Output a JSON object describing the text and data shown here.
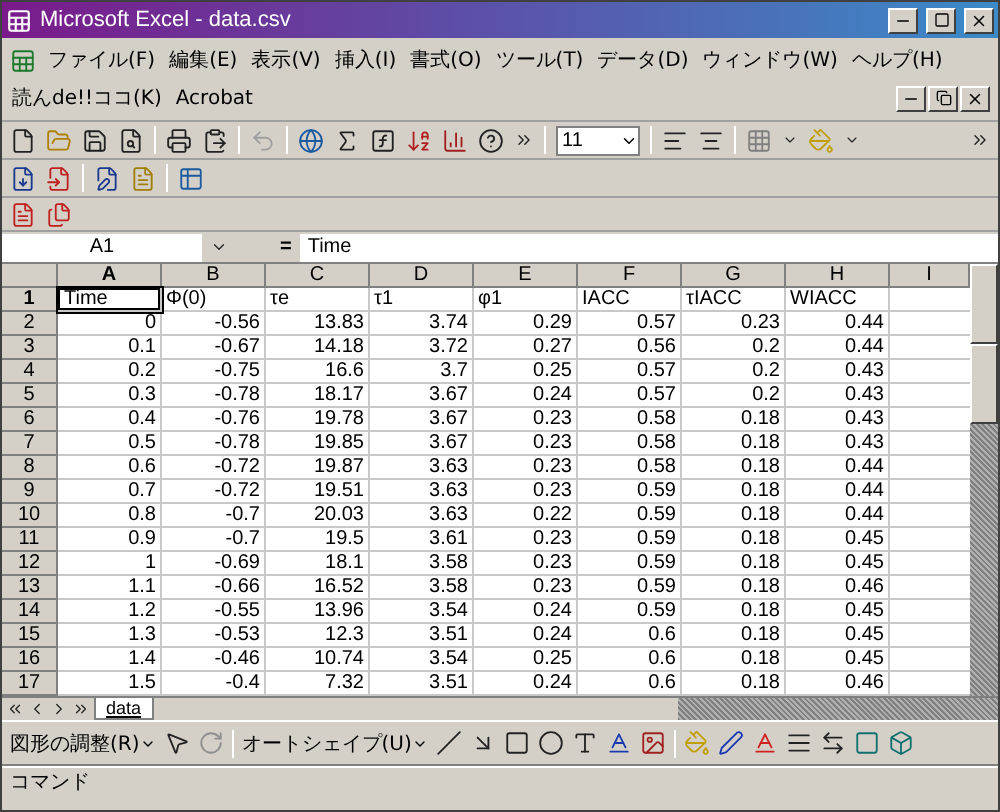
{
  "window": {
    "title": "Microsoft Excel - data.csv"
  },
  "menu": [
    "ファイル(F)",
    "編集(E)",
    "表示(V)",
    "挿入(I)",
    "書式(O)",
    "ツール(T)",
    "データ(D)",
    "ウィンドウ(W)",
    "ヘルプ(H)",
    "読んde!!ココ(K)",
    "Acrobat"
  ],
  "toolbar_standard": {
    "font_size": "11",
    "undo_disabled": true
  },
  "formula_bar": {
    "name_box": "A1",
    "equals": "=",
    "value": "Time"
  },
  "columns": [
    {
      "label": "A",
      "selected": true
    },
    {
      "label": "B",
      "selected": false
    },
    {
      "label": "C",
      "selected": false
    },
    {
      "label": "D",
      "selected": false
    },
    {
      "label": "E",
      "selected": false
    },
    {
      "label": "F",
      "selected": false
    },
    {
      "label": "G",
      "selected": false
    },
    {
      "label": "H",
      "selected": false
    },
    {
      "label": "I",
      "selected": false
    }
  ],
  "rows": [
    {
      "number": "1",
      "selected": true,
      "kind": "text",
      "cells": [
        "Time",
        "Φ(0)",
        "τe",
        "τ1",
        "φ1",
        "IACC",
        "τIACC",
        "WIACC"
      ]
    },
    {
      "number": "2",
      "selected": false,
      "kind": "number",
      "cells": [
        "0",
        "-0.56",
        "13.83",
        "3.74",
        "0.29",
        "0.57",
        "0.23",
        "0.44"
      ]
    },
    {
      "number": "3",
      "selected": false,
      "kind": "number",
      "cells": [
        "0.1",
        "-0.67",
        "14.18",
        "3.72",
        "0.27",
        "0.56",
        "0.2",
        "0.44"
      ]
    },
    {
      "number": "4",
      "selected": false,
      "kind": "number",
      "cells": [
        "0.2",
        "-0.75",
        "16.6",
        "3.7",
        "0.25",
        "0.57",
        "0.2",
        "0.43"
      ]
    },
    {
      "number": "5",
      "selected": false,
      "kind": "number",
      "cells": [
        "0.3",
        "-0.78",
        "18.17",
        "3.67",
        "0.24",
        "0.57",
        "0.2",
        "0.43"
      ]
    },
    {
      "number": "6",
      "selected": false,
      "kind": "number",
      "cells": [
        "0.4",
        "-0.76",
        "19.78",
        "3.67",
        "0.23",
        "0.58",
        "0.18",
        "0.43"
      ]
    },
    {
      "number": "7",
      "selected": false,
      "kind": "number",
      "cells": [
        "0.5",
        "-0.78",
        "19.85",
        "3.67",
        "0.23",
        "0.58",
        "0.18",
        "0.43"
      ]
    },
    {
      "number": "8",
      "selected": false,
      "kind": "number",
      "cells": [
        "0.6",
        "-0.72",
        "19.87",
        "3.63",
        "0.23",
        "0.58",
        "0.18",
        "0.44"
      ]
    },
    {
      "number": "9",
      "selected": false,
      "kind": "number",
      "cells": [
        "0.7",
        "-0.72",
        "19.51",
        "3.63",
        "0.23",
        "0.59",
        "0.18",
        "0.44"
      ]
    },
    {
      "number": "10",
      "selected": false,
      "kind": "number",
      "cells": [
        "0.8",
        "-0.7",
        "20.03",
        "3.63",
        "0.22",
        "0.59",
        "0.18",
        "0.44"
      ]
    },
    {
      "number": "11",
      "selected": false,
      "kind": "number",
      "cells": [
        "0.9",
        "-0.7",
        "19.5",
        "3.61",
        "0.23",
        "0.59",
        "0.18",
        "0.45"
      ]
    },
    {
      "number": "12",
      "selected": false,
      "kind": "number",
      "cells": [
        "1",
        "-0.69",
        "18.1",
        "3.58",
        "0.23",
        "0.59",
        "0.18",
        "0.45"
      ]
    },
    {
      "number": "13",
      "selected": false,
      "kind": "number",
      "cells": [
        "1.1",
        "-0.66",
        "16.52",
        "3.58",
        "0.23",
        "0.59",
        "0.18",
        "0.46"
      ]
    },
    {
      "number": "14",
      "selected": false,
      "kind": "number",
      "cells": [
        "1.2",
        "-0.55",
        "13.96",
        "3.54",
        "0.24",
        "0.59",
        "0.18",
        "0.45"
      ]
    },
    {
      "number": "15",
      "selected": false,
      "kind": "number",
      "cells": [
        "1.3",
        "-0.53",
        "12.3",
        "3.51",
        "0.24",
        "0.6",
        "0.18",
        "0.45"
      ]
    },
    {
      "number": "16",
      "selected": false,
      "kind": "number",
      "cells": [
        "1.4",
        "-0.46",
        "10.74",
        "3.54",
        "0.25",
        "0.6",
        "0.18",
        "0.45"
      ]
    },
    {
      "number": "17",
      "selected": false,
      "kind": "number",
      "cells": [
        "1.5",
        "-0.4",
        "7.32",
        "3.51",
        "0.24",
        "0.6",
        "0.18",
        "0.46"
      ]
    }
  ],
  "sheet_tabs": [
    {
      "label": "data",
      "selected": true
    }
  ],
  "drawing_toolbar": {
    "draw_menu": "図形の調整(R)",
    "autoshapes": "オートシェイプ(U)"
  },
  "status_bar": {
    "text": "コマンド"
  }
}
